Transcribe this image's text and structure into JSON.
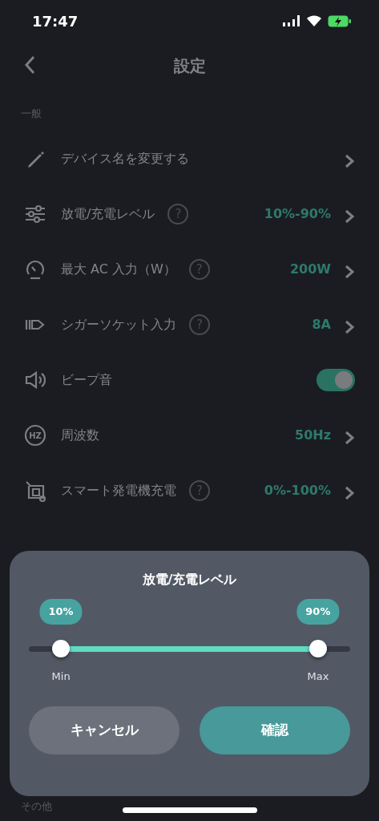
{
  "status_bar": {
    "time": "17:47"
  },
  "nav": {
    "title": "設定"
  },
  "sections": [
    {
      "title": "一般",
      "rows": [
        {
          "kind": "link",
          "label": "デバイス名を変更する"
        },
        {
          "kind": "link",
          "label": "放電/充電レベル",
          "help": "?",
          "value": "10%-90%"
        },
        {
          "kind": "link",
          "label": "最大 AC 入力（W）",
          "help": "?",
          "value": "200W"
        },
        {
          "kind": "link",
          "label": "シガーソケット入力",
          "help": "?",
          "value": "8A"
        },
        {
          "kind": "toggle",
          "label": "ビープ音",
          "on": true
        },
        {
          "kind": "link",
          "label": "周波数",
          "icon_text": "HZ",
          "value": "50Hz"
        },
        {
          "kind": "link",
          "label": "スマート発電機充電",
          "help": "?",
          "value": "0%-100%"
        }
      ]
    },
    {
      "title": "その他"
    }
  ],
  "sheet": {
    "title": "放電/充電レベル",
    "thumbs": [
      {
        "label": "10%",
        "level": 0.1,
        "caption": "Min"
      },
      {
        "label": "90%",
        "level": 0.9,
        "caption": "Max"
      }
    ],
    "buttons": [
      {
        "kind": "secondary",
        "label": "キャンセル"
      },
      {
        "kind": "primary",
        "label": "確認"
      }
    ]
  }
}
